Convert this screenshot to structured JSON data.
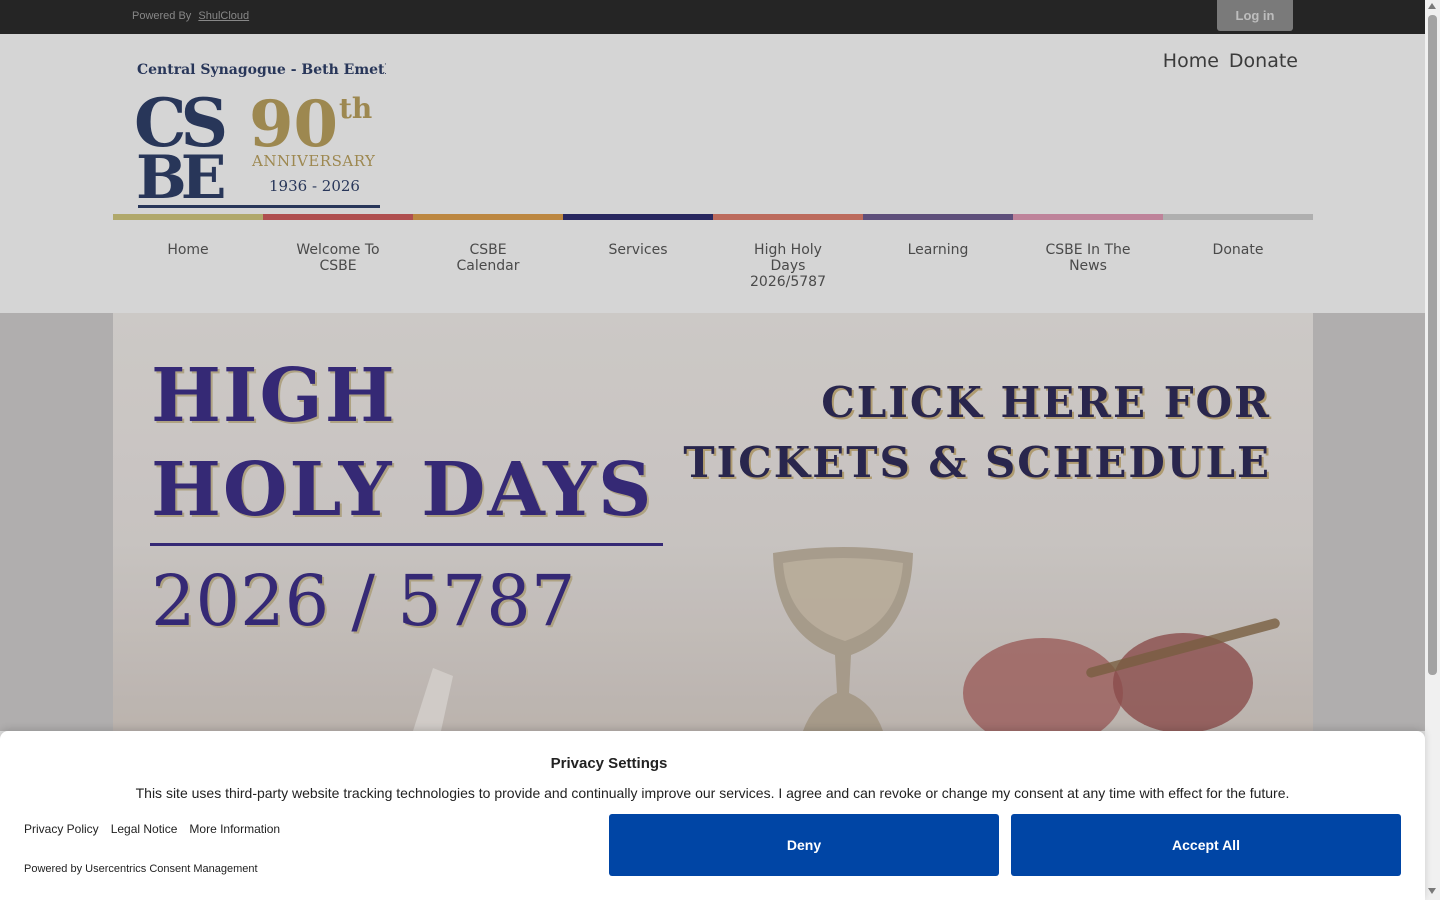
{
  "topbar": {
    "powered_by": "Powered By",
    "powered_link": "ShulCloud",
    "login_label": "Log in"
  },
  "logo": {
    "name": "Central Synagogue - Beth Emeth",
    "monogram_top": "CS",
    "monogram_bottom": "BE",
    "anniversary_number": "90",
    "anniversary_suffix": "th",
    "anniversary_word": "ANNIVERSARY",
    "years": "1936 - 2026",
    "colors": {
      "navy": "#2e3e66",
      "gold": "#b39b5c"
    }
  },
  "utility_nav": [
    "Home",
    "Donate"
  ],
  "color_bar": [
    "#c9c07a",
    "#c85a5a",
    "#d79a4a",
    "#2f2e6e",
    "#d77a6a",
    "#6b5a8c",
    "#d996b0",
    "#c8c8c8"
  ],
  "main_nav": [
    "Home",
    "Welcome To CSBE",
    "CSBE Calendar",
    "Services",
    "High Holy Days 2026/5787",
    "Learning",
    "CSBE In The News",
    "Donate"
  ],
  "hero": {
    "title_line1": "HIGH",
    "title_line2": "HOLY DAYS",
    "year": "2026 / 5787",
    "cta_line1": "CLICK HERE FOR",
    "cta_line2": "TICKETS & SCHEDULE",
    "accent_color": "#3d2f86"
  },
  "consent": {
    "title": "Privacy Settings",
    "text": "This site uses third-party website tracking technologies to provide and continually improve our services. I agree and can revoke or change my consent at any time with effect for the future.",
    "links": [
      "Privacy Policy",
      "Legal Notice",
      "More Information"
    ],
    "powered": "Powered by Usercentrics Consent Management",
    "deny_label": "Deny",
    "accept_label": "Accept All",
    "button_color": "#0045a5"
  }
}
